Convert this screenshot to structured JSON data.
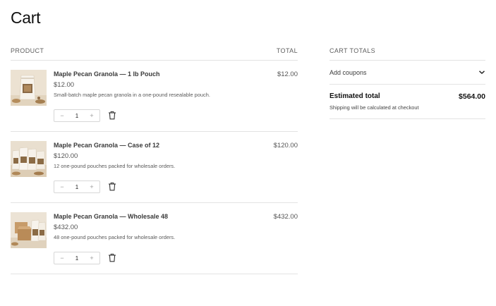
{
  "page": {
    "title": "Cart"
  },
  "cart": {
    "columns": {
      "product": "PRODUCT",
      "total": "TOTAL"
    },
    "items": [
      {
        "name": "Maple Pecan Granola — 1 lb Pouch",
        "price": "$12.00",
        "description": "Small-batch maple pecan granola in a one-pound resealable pouch.",
        "quantity": "1",
        "total": "$12.00",
        "image_icon": "granola-pouch-photo"
      },
      {
        "name": "Maple Pecan Granola — Case of 12",
        "price": "$120.00",
        "description": "12 one-pound pouches packed for wholesale orders.",
        "quantity": "1",
        "total": "$120.00",
        "image_icon": "granola-case-photo"
      },
      {
        "name": "Maple Pecan Granola — Wholesale 48",
        "price": "$432.00",
        "description": "48 one-pound pouches packed for wholesale orders.",
        "quantity": "1",
        "total": "$432.00",
        "image_icon": "granola-wholesale-photo"
      }
    ],
    "qty_controls": {
      "decrement": "−",
      "increment": "+"
    }
  },
  "totals": {
    "heading": "CART TOTALS",
    "coupon_label": "Add coupons",
    "estimated_label": "Estimated total",
    "estimated_value": "$564.00",
    "shipping_note": "Shipping will be calculated at checkout"
  },
  "colors": {
    "text": "#1e1e1e",
    "muted": "#5f5f5f",
    "divider": "#e3e3e3",
    "thumb_bg": "#ede4d6"
  }
}
